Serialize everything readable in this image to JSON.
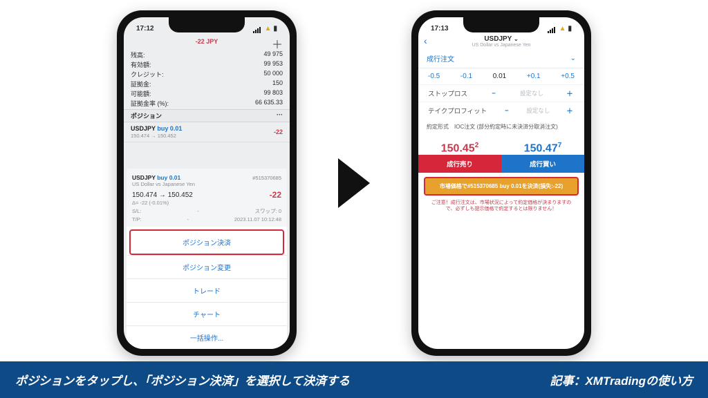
{
  "phone1": {
    "time": "17:12",
    "title": "-22 JPY",
    "balance": {
      "labels": [
        "残高:",
        "有効額:",
        "クレジット:",
        "証拠金:",
        "可能額:",
        "証拠金率 (%):"
      ],
      "values": [
        "49 975",
        "99 953",
        "50 000",
        "150",
        "99 803",
        "66 635.33"
      ]
    },
    "section_positions": "ポジション",
    "section_dots": "···",
    "position": {
      "pair": "USDJPY",
      "vol": "buy 0.01",
      "prices": "150.474 → 150.452",
      "pl": "-22"
    },
    "card": {
      "pair": "USDJPY",
      "vol": "buy 0.01",
      "id": "#515370685",
      "sub": "US Dollar vs Japanese Yen",
      "prices": "150.474 → 150.452",
      "pl": "-22",
      "delta": "Δ= -22 (-0.01%)",
      "sl_label": "S/L:",
      "tp_label": "T/P:",
      "swap_label": "スワップ: 0",
      "ts": "2023.11.07 10:12:48"
    },
    "menu": {
      "close": "ポジション決済",
      "modify": "ポジション変更",
      "trade": "トレード",
      "chart": "チャート",
      "bulk": "一括操作..."
    }
  },
  "phone2": {
    "time": "17:13",
    "title": "USDJPY",
    "subtitle": "US Dollar vs Japanese Yen",
    "order_type": "成行注文",
    "steps": {
      "m05": "-0.5",
      "m01": "-0.1",
      "cur": "0.01",
      "p01": "+0.1",
      "p05": "+0.5"
    },
    "sl": {
      "label": "ストップロス",
      "val": "設定なし"
    },
    "tp": {
      "label": "テイクプロフィット",
      "val": "設定なし"
    },
    "ioc": "約定形式　IOC注文 (部分約定時に未決済分取消注文)",
    "price_sell": "150.45",
    "price_sell_sup": "2",
    "price_buy": "150.47",
    "price_buy_sup": "7",
    "btn_sell": "成行売り",
    "btn_buy": "成行買い",
    "close_text": "市場価格で#515370685 buy 0.01を決済(損失:-22)",
    "warning": "ご注意！成行注文は、市場状況によって約定価格が決まりますので、必ずしも提示価格で約定するとは限りません！"
  },
  "footer": {
    "left": "ポジションをタップし、「ポジション決済」を選択して決済する",
    "right": "記事：XMTradingの使い方"
  }
}
